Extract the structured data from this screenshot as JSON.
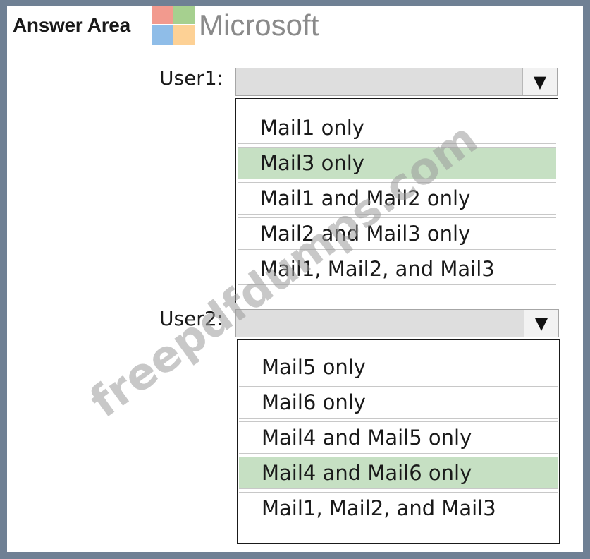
{
  "header": {
    "title": "Answer Area",
    "logo_text": "Microsoft"
  },
  "colors": {
    "logo_red": "#f29a8e",
    "logo_green": "#a6d08f",
    "logo_blue": "#8fbde8",
    "logo_yellow": "#fdd195",
    "selected_bg": "#c6e0c3"
  },
  "user1": {
    "label": "User1:",
    "selected_value": "",
    "options": [
      {
        "label": "Mail1 only",
        "selected": false
      },
      {
        "label": "Mail3 only",
        "selected": true
      },
      {
        "label": "Mail1 and Mail2 only",
        "selected": false
      },
      {
        "label": "Mail2 and Mail3 only",
        "selected": false
      },
      {
        "label": "Mail1, Mail2, and Mail3",
        "selected": false
      }
    ]
  },
  "user2": {
    "label": "User2:",
    "selected_value": "",
    "options": [
      {
        "label": "Mail5 only",
        "selected": false
      },
      {
        "label": "Mail6 only",
        "selected": false
      },
      {
        "label": "Mail4 and Mail5 only",
        "selected": false
      },
      {
        "label": "Mail4 and Mail6 only",
        "selected": true
      },
      {
        "label": "Mail1, Mail2, and Mail3",
        "selected": false
      }
    ]
  },
  "watermark": {
    "text": "freepdfdumps.com"
  },
  "icons": {
    "dropdown_arrow": "chevron-down-icon"
  }
}
